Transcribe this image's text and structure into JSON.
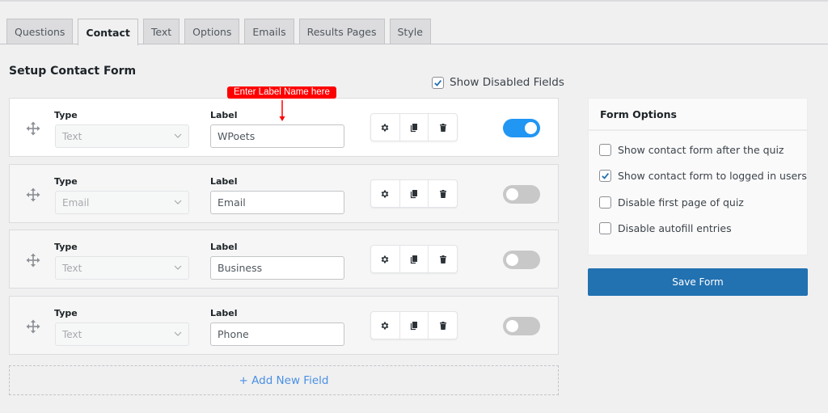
{
  "tabs": [
    {
      "label": "Questions",
      "active": false
    },
    {
      "label": "Contact",
      "active": true
    },
    {
      "label": "Text",
      "active": false
    },
    {
      "label": "Options",
      "active": false
    },
    {
      "label": "Emails",
      "active": false
    },
    {
      "label": "Results Pages",
      "active": false
    },
    {
      "label": "Style",
      "active": false
    }
  ],
  "page_title": "Setup Contact Form",
  "show_disabled_fields": {
    "label": "Show Disabled Fields",
    "checked": true
  },
  "callout": {
    "text": "Enter Label Name here",
    "color": "#ff0000"
  },
  "field_headers": {
    "type": "Type",
    "label": "Label"
  },
  "fields": [
    {
      "type": "Text",
      "label": "WPoets",
      "enabled": true
    },
    {
      "type": "Email",
      "label": "Email",
      "enabled": false
    },
    {
      "type": "Text",
      "label": "Business",
      "enabled": false
    },
    {
      "type": "Text",
      "label": "Phone",
      "enabled": false
    }
  ],
  "field_actions": [
    "settings-icon",
    "duplicate-icon",
    "trash-icon"
  ],
  "add_field_label": "+ Add New Field",
  "form_options": {
    "title": "Form Options",
    "items": [
      {
        "label": "Show contact form after the quiz",
        "checked": false
      },
      {
        "label": "Show contact form to logged in users",
        "checked": true
      },
      {
        "label": "Disable first page of quiz",
        "checked": false
      },
      {
        "label": "Disable autofill entries",
        "checked": false
      }
    ]
  },
  "save_button": "Save Form",
  "colors": {
    "accent": "#2271b1",
    "toggle_on": "#2196f3",
    "link": "#4a90e2"
  }
}
